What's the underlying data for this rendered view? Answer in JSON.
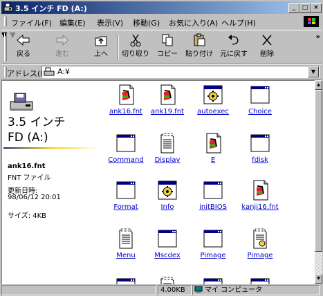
{
  "window": {
    "title": "3.5 インチ FD (A:)"
  },
  "menu": [
    "ファイル(F)",
    "編集(E)",
    "表示(V)",
    "移動(G)",
    "お気に入り(A)",
    "ヘルプ(H)"
  ],
  "toolbar": {
    "back": "戻る",
    "forward": "進む",
    "up": "上へ",
    "cut": "切り取り",
    "copy": "コピー",
    "paste": "貼り付け",
    "undo": "元に戻す",
    "delete": "削除",
    "more": "»"
  },
  "address": {
    "label": "アドレス(D)",
    "value": "A:¥"
  },
  "side_panel": {
    "title_line1": "3.5 インチ",
    "title_line2": "FD (A:)",
    "file_name": "ank16.fnt",
    "file_type": "FNT ファイル",
    "modified_label": "更新日時:",
    "modified_value": "98/06/12 20:01",
    "size": "サイズ: 4KB"
  },
  "files": [
    {
      "name": "ank16.fnt",
      "icon": "font-file-icon"
    },
    {
      "name": "ank19.fnt",
      "icon": "font-file-icon"
    },
    {
      "name": "autoexec",
      "icon": "batch-file-icon"
    },
    {
      "name": "Choice",
      "icon": "msdos-program-icon"
    },
    {
      "name": "Command",
      "icon": "msdos-program-icon"
    },
    {
      "name": "Display",
      "icon": "text-document-icon"
    },
    {
      "name": "E",
      "icon": "font-file-icon"
    },
    {
      "name": "fdisk",
      "icon": "msdos-program-icon"
    },
    {
      "name": "Format",
      "icon": "msdos-program-icon"
    },
    {
      "name": "Info",
      "icon": "batch-file-icon"
    },
    {
      "name": "initBIOS",
      "icon": "msdos-program-icon"
    },
    {
      "name": "kanji16.fnt",
      "icon": "font-file-icon"
    },
    {
      "name": "Menu",
      "icon": "text-document-icon"
    },
    {
      "name": "Mscdex",
      "icon": "msdos-program-icon"
    },
    {
      "name": "Pimage",
      "icon": "msdos-program-icon"
    },
    {
      "name": "Pimage",
      "icon": "system-file-icon"
    }
  ],
  "status": {
    "size": "4.00KB",
    "zone": "マイ コンピュータ"
  },
  "colors": {
    "titlebar_start": "#0a246a",
    "titlebar_end": "#a6caf0",
    "link": "#0000cc"
  }
}
